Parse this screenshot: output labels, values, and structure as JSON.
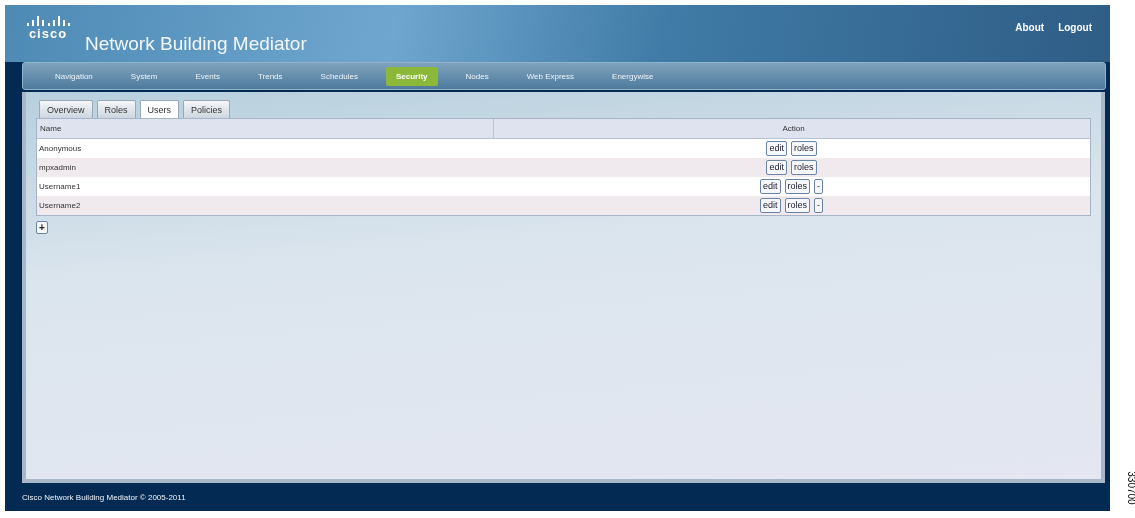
{
  "header": {
    "brand": "cisco",
    "title": "Network Building Mediator",
    "links": [
      "About",
      "Logout"
    ]
  },
  "nav": [
    {
      "label": "Navigation",
      "selected": false
    },
    {
      "label": "System",
      "selected": false
    },
    {
      "label": "Events",
      "selected": false
    },
    {
      "label": "Trends",
      "selected": false
    },
    {
      "label": "Schedules",
      "selected": false
    },
    {
      "label": "Security",
      "selected": true
    },
    {
      "label": "Nodes",
      "selected": false
    },
    {
      "label": "Web Express",
      "selected": false
    },
    {
      "label": "Energywise",
      "selected": false
    }
  ],
  "tabs": [
    {
      "label": "Overview",
      "selected": false
    },
    {
      "label": "Roles",
      "selected": false
    },
    {
      "label": "Users",
      "selected": true
    },
    {
      "label": "Policies",
      "selected": false
    }
  ],
  "table": {
    "columns": [
      "Name",
      "Action"
    ],
    "rows": [
      {
        "name": "Anonymous",
        "actions": [
          "edit",
          "roles"
        ]
      },
      {
        "name": "mpxadmin",
        "actions": [
          "edit",
          "roles"
        ]
      },
      {
        "name": "Username1",
        "actions": [
          "edit",
          "roles",
          "-"
        ]
      },
      {
        "name": "Username2",
        "actions": [
          "edit",
          "roles",
          "-"
        ]
      }
    ]
  },
  "add_button": "+",
  "footer": "Cisco Network Building Mediator © 2005-2011",
  "figure_number": "330700"
}
